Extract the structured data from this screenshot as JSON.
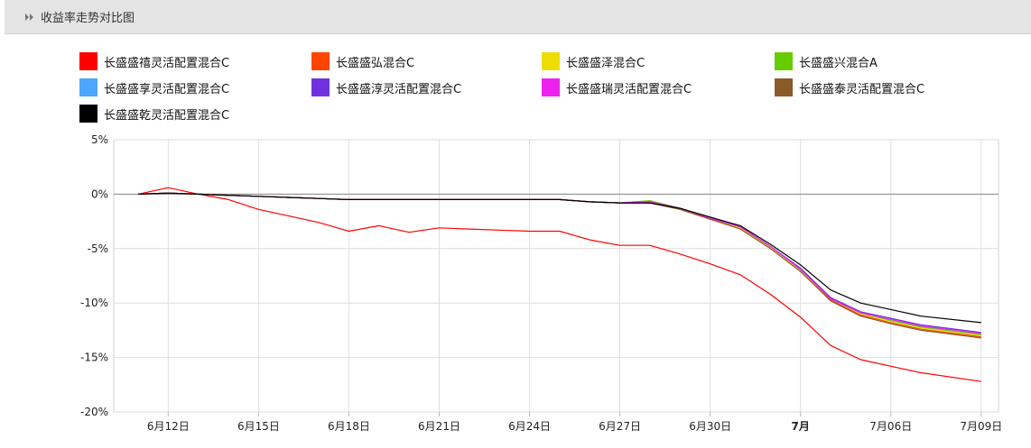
{
  "header": {
    "title": "收益率走势对比图",
    "icon": "double-chevron-right-icon"
  },
  "chart_data": {
    "type": "line",
    "title": "收益率走势对比图",
    "xlabel": "",
    "ylabel": "",
    "ylim": [
      -20,
      5
    ],
    "yticks": [
      5,
      0,
      -5,
      -10,
      -15,
      -20
    ],
    "ytick_labels": [
      "5%",
      "0%",
      "-5%",
      "-10%",
      "-15%",
      "-20%"
    ],
    "x_dates": [
      "06-11",
      "06-12",
      "06-13",
      "06-14",
      "06-15",
      "06-16",
      "06-17",
      "06-18",
      "06-19",
      "06-20",
      "06-21",
      "06-22",
      "06-23",
      "06-24",
      "06-25",
      "06-26",
      "06-27",
      "06-28",
      "06-29",
      "06-30",
      "07-01",
      "07-02",
      "07-03",
      "07-04",
      "07-05",
      "07-06",
      "07-07",
      "07-08",
      "07-09"
    ],
    "xticks": [
      {
        "date": "06-12",
        "label": "6月12日",
        "bold": false
      },
      {
        "date": "06-15",
        "label": "6月15日",
        "bold": false
      },
      {
        "date": "06-18",
        "label": "6月18日",
        "bold": false
      },
      {
        "date": "06-21",
        "label": "6月21日",
        "bold": false
      },
      {
        "date": "06-24",
        "label": "6月24日",
        "bold": false
      },
      {
        "date": "06-27",
        "label": "6月27日",
        "bold": false
      },
      {
        "date": "06-30",
        "label": "6月30日",
        "bold": false
      },
      {
        "date": "07-03",
        "label": "7月",
        "bold": true
      },
      {
        "date": "07-06",
        "label": "7月06日",
        "bold": false
      },
      {
        "date": "07-09",
        "label": "7月09日",
        "bold": false
      }
    ],
    "reference_line": 0,
    "grid": true,
    "legend_position": "top",
    "series": [
      {
        "name": "长盛盛禧灵活配置混合C",
        "color": "#ff0000",
        "x": [
          "06-11",
          "06-12",
          "06-13",
          "06-14",
          "06-15",
          "06-16",
          "06-17",
          "06-18",
          "06-19",
          "06-20",
          "06-21",
          "06-22",
          "06-23",
          "06-24",
          "06-25",
          "06-26",
          "06-27",
          "06-28",
          "06-29",
          "06-30",
          "07-01",
          "07-02",
          "07-03",
          "07-04",
          "07-05",
          "07-06",
          "07-07",
          "07-09"
        ],
        "y": [
          0,
          0.6,
          0,
          -0.5,
          -1.4,
          -2.0,
          -2.6,
          -3.4,
          -2.9,
          -3.5,
          -3.1,
          -3.2,
          -3.3,
          -3.4,
          -3.4,
          -4.2,
          -4.7,
          -4.7,
          -5.5,
          -6.4,
          -7.4,
          -9.2,
          -11.3,
          -13.9,
          -15.2,
          -15.8,
          -16.4,
          -17.2
        ]
      },
      {
        "name": "长盛盛弘混合C",
        "color": "#ff4500",
        "x": [
          "06-11",
          "06-12",
          "06-13",
          "06-14",
          "06-15",
          "06-16",
          "06-17",
          "06-18",
          "06-19",
          "06-20",
          "06-21",
          "06-22",
          "06-23",
          "06-24",
          "06-25",
          "06-26",
          "06-27",
          "06-28",
          "06-29",
          "06-30",
          "07-01",
          "07-02",
          "07-03",
          "07-04",
          "07-05",
          "07-06",
          "07-07",
          "07-09"
        ],
        "y": [
          0,
          0.1,
          0,
          -0.1,
          -0.2,
          -0.3,
          -0.4,
          -0.5,
          -0.5,
          -0.5,
          -0.5,
          -0.5,
          -0.5,
          -0.5,
          -0.5,
          -0.7,
          -0.8,
          -0.8,
          -1.4,
          -2.3,
          -3.1,
          -4.9,
          -7.1,
          -9.7,
          -11.1,
          -11.8,
          -12.4,
          -13.1
        ]
      },
      {
        "name": "长盛盛泽混合C",
        "color": "#eedd00",
        "x": [
          "06-11",
          "06-12",
          "06-13",
          "06-14",
          "06-15",
          "06-16",
          "06-17",
          "06-18",
          "06-19",
          "06-20",
          "06-21",
          "06-22",
          "06-23",
          "06-24",
          "06-25",
          "06-26",
          "06-27",
          "06-28",
          "06-29",
          "06-30",
          "07-01",
          "07-02",
          "07-03",
          "07-04",
          "07-05",
          "07-06",
          "07-07",
          "07-09"
        ],
        "y": [
          0,
          0.1,
          0,
          -0.1,
          -0.2,
          -0.3,
          -0.4,
          -0.5,
          -0.5,
          -0.5,
          -0.5,
          -0.5,
          -0.5,
          -0.5,
          -0.5,
          -0.7,
          -0.8,
          -0.7,
          -1.4,
          -2.2,
          -3.1,
          -4.9,
          -7.0,
          -9.6,
          -11.0,
          -11.7,
          -12.3,
          -13.0
        ]
      },
      {
        "name": "长盛盛兴混合A",
        "color": "#66cc00",
        "x": [
          "06-11",
          "06-12",
          "06-13",
          "06-14",
          "06-15",
          "06-16",
          "06-17",
          "06-18",
          "06-19",
          "06-20",
          "06-21",
          "06-22",
          "06-23",
          "06-24",
          "06-25",
          "06-26",
          "06-27",
          "06-28",
          "06-29",
          "06-30",
          "07-01",
          "07-02",
          "07-03",
          "07-04",
          "07-05",
          "07-06",
          "07-07",
          "07-09"
        ],
        "y": [
          0,
          0.1,
          0,
          -0.1,
          -0.2,
          -0.3,
          -0.4,
          -0.5,
          -0.5,
          -0.5,
          -0.5,
          -0.5,
          -0.5,
          -0.5,
          -0.5,
          -0.7,
          -0.8,
          -0.6,
          -1.3,
          -2.2,
          -3.0,
          -4.8,
          -6.9,
          -9.6,
          -10.9,
          -11.6,
          -12.2,
          -12.9
        ]
      },
      {
        "name": "长盛盛享灵活配置混合C",
        "color": "#4da6ff",
        "x": [
          "06-11",
          "06-12",
          "06-13",
          "06-14",
          "06-15",
          "06-16",
          "06-17",
          "06-18",
          "06-19",
          "06-20",
          "06-21",
          "06-22",
          "06-23",
          "06-24",
          "06-25",
          "06-26",
          "06-27",
          "06-28",
          "06-29",
          "06-30",
          "07-01",
          "07-02",
          "07-03",
          "07-04",
          "07-05",
          "07-06",
          "07-07",
          "07-09"
        ],
        "y": [
          0,
          0.1,
          0,
          -0.1,
          -0.2,
          -0.3,
          -0.4,
          -0.5,
          -0.5,
          -0.5,
          -0.5,
          -0.5,
          -0.5,
          -0.5,
          -0.5,
          -0.7,
          -0.8,
          -0.7,
          -1.3,
          -2.2,
          -3.0,
          -4.8,
          -6.9,
          -9.5,
          -10.9,
          -11.5,
          -12.1,
          -12.8
        ]
      },
      {
        "name": "长盛盛淳灵活配置混合C",
        "color": "#7030e0",
        "x": [
          "06-11",
          "06-12",
          "06-13",
          "06-14",
          "06-15",
          "06-16",
          "06-17",
          "06-18",
          "06-19",
          "06-20",
          "06-21",
          "06-22",
          "06-23",
          "06-24",
          "06-25",
          "06-26",
          "06-27",
          "06-28",
          "06-29",
          "06-30",
          "07-01",
          "07-02",
          "07-03",
          "07-04",
          "07-05",
          "07-06",
          "07-07",
          "07-09"
        ],
        "y": [
          0,
          0.1,
          0,
          -0.1,
          -0.2,
          -0.3,
          -0.4,
          -0.5,
          -0.5,
          -0.5,
          -0.5,
          -0.5,
          -0.5,
          -0.5,
          -0.5,
          -0.7,
          -0.8,
          -0.7,
          -1.3,
          -2.2,
          -3.0,
          -4.8,
          -6.8,
          -9.5,
          -10.8,
          -11.4,
          -12.0,
          -12.7
        ]
      },
      {
        "name": "长盛盛瑞灵活配置混合C",
        "color": "#ee22ee",
        "x": [
          "06-11",
          "06-12",
          "06-13",
          "06-14",
          "06-15",
          "06-16",
          "06-17",
          "06-18",
          "06-19",
          "06-20",
          "06-21",
          "06-22",
          "06-23",
          "06-24",
          "06-25",
          "06-26",
          "06-27",
          "06-28",
          "06-29",
          "06-30",
          "07-01",
          "07-02",
          "07-03",
          "07-04",
          "07-05",
          "07-06",
          "07-07",
          "07-09"
        ],
        "y": [
          0,
          0.1,
          0,
          -0.1,
          -0.2,
          -0.3,
          -0.4,
          -0.5,
          -0.5,
          -0.5,
          -0.5,
          -0.5,
          -0.5,
          -0.5,
          -0.5,
          -0.7,
          -0.8,
          -0.7,
          -1.3,
          -2.2,
          -3.0,
          -4.8,
          -6.9,
          -9.6,
          -10.9,
          -11.5,
          -12.1,
          -12.8
        ]
      },
      {
        "name": "长盛盛泰灵活配置混合C",
        "color": "#8b5a2b",
        "x": [
          "06-11",
          "06-12",
          "06-13",
          "06-14",
          "06-15",
          "06-16",
          "06-17",
          "06-18",
          "06-19",
          "06-20",
          "06-21",
          "06-22",
          "06-23",
          "06-24",
          "06-25",
          "06-26",
          "06-27",
          "06-28",
          "06-29",
          "06-30",
          "07-01",
          "07-02",
          "07-03",
          "07-04",
          "07-05",
          "07-06",
          "07-07",
          "07-09"
        ],
        "y": [
          0,
          0.1,
          0,
          -0.1,
          -0.2,
          -0.3,
          -0.4,
          -0.5,
          -0.5,
          -0.5,
          -0.5,
          -0.5,
          -0.5,
          -0.5,
          -0.5,
          -0.7,
          -0.8,
          -0.8,
          -1.4,
          -2.3,
          -3.2,
          -5.0,
          -7.1,
          -9.8,
          -11.2,
          -11.9,
          -12.5,
          -13.2
        ]
      },
      {
        "name": "长盛盛乾灵活配置混合C",
        "color": "#000000",
        "x": [
          "06-11",
          "06-12",
          "06-13",
          "06-14",
          "06-15",
          "06-16",
          "06-17",
          "06-18",
          "06-19",
          "06-20",
          "06-21",
          "06-22",
          "06-23",
          "06-24",
          "06-25",
          "06-26",
          "06-27",
          "06-28",
          "06-29",
          "06-30",
          "07-01",
          "07-02",
          "07-03",
          "07-04",
          "07-05",
          "07-06",
          "07-07",
          "07-09"
        ],
        "y": [
          0,
          0.1,
          0,
          -0.1,
          -0.2,
          -0.3,
          -0.4,
          -0.5,
          -0.5,
          -0.5,
          -0.5,
          -0.5,
          -0.5,
          -0.5,
          -0.5,
          -0.7,
          -0.8,
          -0.8,
          -1.3,
          -2.1,
          -2.9,
          -4.6,
          -6.5,
          -8.8,
          -10.0,
          -10.6,
          -11.2,
          -11.8
        ]
      }
    ]
  }
}
